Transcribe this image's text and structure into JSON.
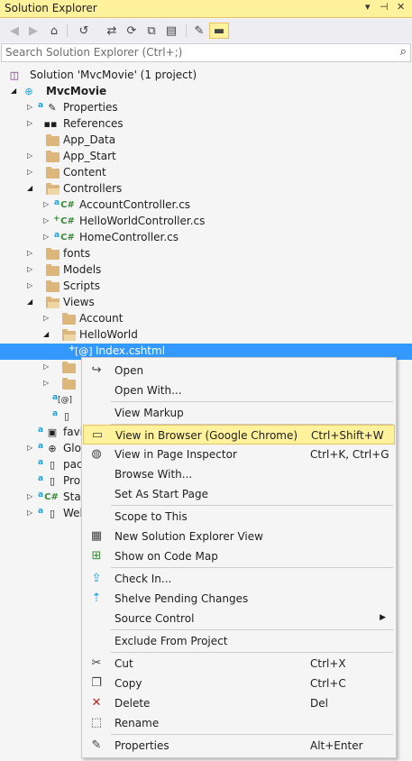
{
  "window": {
    "title": "Solution Explorer",
    "dropdown_glyph": "▾",
    "pin_glyph": "⊣",
    "close_glyph": "✕"
  },
  "toolbar": {
    "back_glyph": "◀",
    "forward_glyph": "▶",
    "home_glyph": "⌂",
    "history_glyph": "↺",
    "sync_glyph": "⇄",
    "refresh_glyph": "⟳",
    "collapse_glyph": "⧉",
    "show_all_glyph": "▤",
    "properties_glyph": "✎",
    "preview_glyph": "▬"
  },
  "search": {
    "placeholder": "Search Solution Explorer (Ctrl+;)",
    "icon_glyph": "⌕"
  },
  "tree": {
    "solution_label": "Solution 'MvcMovie' (1 project)",
    "project_label": "MvcMovie",
    "items": {
      "properties": "Properties",
      "references": "References",
      "app_data": "App_Data",
      "app_start": "App_Start",
      "content": "Content",
      "controllers": "Controllers",
      "account_controller": "AccountController.cs",
      "helloworld_controller": "HelloWorldController.cs",
      "home_controller": "HomeController.cs",
      "fonts": "fonts",
      "models": "Models",
      "scripts": "Scripts",
      "views": "Views",
      "account": "Account",
      "helloworld": "HelloWorld",
      "index_cshtml": "Index.cshtml",
      "favicon_partial": "favi",
      "global_partial": "Glo",
      "packages_partial": "pac",
      "project_partial": "Pro",
      "startup_partial": "Star",
      "webconfig_partial": "Wel"
    }
  },
  "context_menu": {
    "open": "Open",
    "open_with": "Open With...",
    "view_markup": "View Markup",
    "view_in_browser": "View in Browser (Google Chrome)",
    "view_in_browser_shortcut": "Ctrl+Shift+W",
    "view_in_page_inspector": "View in Page Inspector",
    "view_in_page_inspector_shortcut": "Ctrl+K, Ctrl+G",
    "browse_with": "Browse With...",
    "set_as_start_page": "Set As Start Page",
    "scope_to_this": "Scope to This",
    "new_solution_explorer_view": "New Solution Explorer View",
    "show_on_code_map": "Show on Code Map",
    "check_in": "Check In...",
    "shelve_pending_changes": "Shelve Pending Changes",
    "source_control": "Source Control",
    "exclude_from_project": "Exclude From Project",
    "cut": "Cut",
    "cut_shortcut": "Ctrl+X",
    "copy": "Copy",
    "copy_shortcut": "Ctrl+C",
    "delete": "Delete",
    "delete_shortcut": "Del",
    "rename": "Rename",
    "properties": "Properties",
    "properties_shortcut": "Alt+Enter"
  },
  "colors": {
    "title_bar": "#fff29d",
    "selection": "#3399ff",
    "folder": "#dcb67a",
    "csharp": "#388a34",
    "lock": "#1ba1e2",
    "delete_icon": "#c5221f"
  }
}
